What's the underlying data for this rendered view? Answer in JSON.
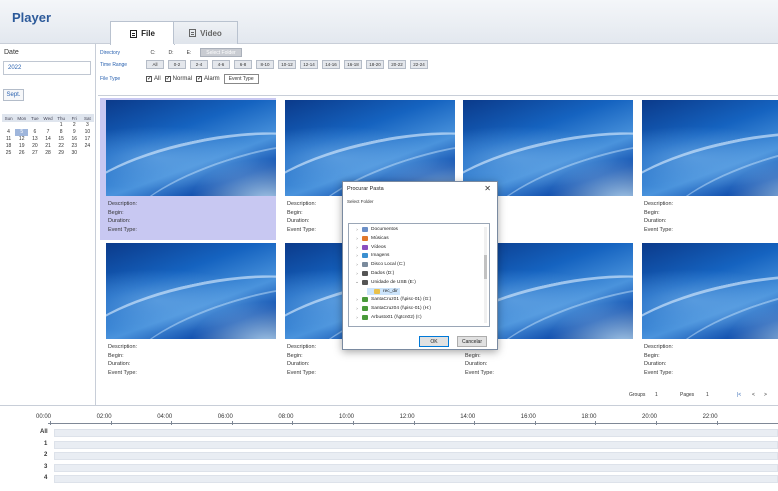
{
  "header": {
    "title": "Player",
    "tabs": [
      {
        "label": "File",
        "active": true
      },
      {
        "label": "Video",
        "active": false
      }
    ]
  },
  "left_panel": {
    "date_label": "Date",
    "year_value": "2022",
    "month_value": "Sept.",
    "calendar": {
      "weekdays": [
        "Sun",
        "Mon",
        "Tue",
        "Wed",
        "Thu",
        "Fri",
        "Sat"
      ],
      "weeks": [
        [
          "",
          "",
          "",
          "",
          "1",
          "2",
          "3"
        ],
        [
          "4",
          "5",
          "6",
          "7",
          "8",
          "9",
          "10"
        ],
        [
          "11",
          "12",
          "13",
          "14",
          "15",
          "16",
          "17"
        ],
        [
          "18",
          "19",
          "20",
          "21",
          "22",
          "23",
          "24"
        ],
        [
          "25",
          "26",
          "27",
          "28",
          "29",
          "30",
          ""
        ]
      ],
      "selected_day": "5"
    }
  },
  "filters": {
    "directory_label": "Directory",
    "drives": [
      "C:",
      "D:",
      "E:"
    ],
    "select_folder_label": "Select Folder",
    "time_range_label": "Time Range",
    "time_ranges": [
      "All",
      "0-2",
      "2-4",
      "4-6",
      "6-8",
      "8-10",
      "10-12",
      "12-14",
      "14-16",
      "16-18",
      "18-20",
      "20-22",
      "22-24"
    ],
    "file_type_label": "File Type",
    "file_types": [
      "All",
      "Normal",
      "Alarm"
    ],
    "event_type_button": "Event Type"
  },
  "tiles": [
    {
      "description": "Description:",
      "begin": "Begin:",
      "duration": "Duration:",
      "event_type": "Event Type:"
    },
    {
      "description": "Description:",
      "begin": "Begin:",
      "duration": "Duration:",
      "event_type": "Event Type:"
    },
    {
      "description": "",
      "begin": "",
      "duration": "",
      "event_type": ""
    },
    {
      "description": "Description:",
      "begin": "Begin:",
      "duration": "Duration:",
      "event_type": "Event Type:"
    },
    {
      "description": "Description:",
      "begin": "Begin:",
      "duration": "Duration:",
      "event_type": "Event Type:"
    },
    {
      "description": "Description:",
      "begin": "Begin:",
      "duration": "Duration:",
      "event_type": "Event Type:"
    },
    {
      "description": "Description:",
      "begin": "Begin:",
      "duration": "Duration:",
      "event_type": "Event Type:"
    },
    {
      "description": "Description:",
      "begin": "Begin:",
      "duration": "Duration:",
      "event_type": "Event Type:"
    }
  ],
  "dialog": {
    "title": "Procurar Pasta",
    "close": "✕",
    "subtitle": "Select Folder",
    "tree": [
      {
        "label": "Documentos",
        "icon": "documents-icon",
        "color": "#6b8fc7",
        "expanded": false
      },
      {
        "label": "Músicas",
        "icon": "music-icon",
        "color": "#e0782b",
        "expanded": false
      },
      {
        "label": "Vídeos",
        "icon": "videos-icon",
        "color": "#8a4fc0",
        "expanded": false
      },
      {
        "label": "Imagens",
        "icon": "images-icon",
        "color": "#3a8fd0",
        "expanded": false
      },
      {
        "label": "Disco Local (C:)",
        "icon": "drive-icon",
        "color": "#7a8a9c",
        "expanded": false
      },
      {
        "label": "Dados (D:)",
        "icon": "drive-icon",
        "color": "#555555",
        "expanded": false
      },
      {
        "label": "Unidade de USB (E:)",
        "icon": "usb-drive-icon",
        "color": "#555555",
        "expanded": true
      },
      {
        "label": "rec_dir",
        "icon": "folder-icon",
        "color": "#e8c04a",
        "expanded": false
      },
      {
        "label": "SantaCruz01 (\\\\pisc-01) (G:)",
        "icon": "network-drive-icon",
        "color": "#4a9a3a",
        "expanded": false
      },
      {
        "label": "SantaCruz04 (\\\\pisc-01) (H:)",
        "icon": "network-drive-icon",
        "color": "#4a9a3a",
        "expanded": false
      },
      {
        "label": "Arbusto01 (\\\\gtcn02) (I:)",
        "icon": "network-drive-icon",
        "color": "#4a9a3a",
        "expanded": false
      }
    ],
    "ok_label": "OK",
    "cancel_label": "Cancelar"
  },
  "pager": {
    "groups_label": "Groups",
    "groups_value": "1",
    "pages_label": "Pages",
    "pages_value": "1",
    "nav": [
      "|<",
      "<",
      ">"
    ]
  },
  "timeline": {
    "hours": [
      "00:00",
      "02:00",
      "04:00",
      "06:00",
      "08:00",
      "10:00",
      "12:00",
      "14:00",
      "16:00",
      "18:00",
      "20:00",
      "22:00"
    ],
    "rows": [
      "All",
      "1",
      "2",
      "3",
      "4"
    ]
  }
}
